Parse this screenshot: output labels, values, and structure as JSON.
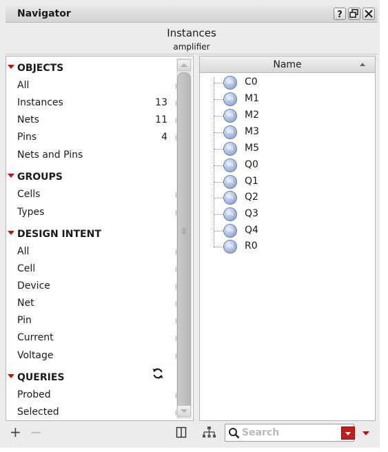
{
  "window": {
    "title": "Navigator"
  },
  "header": {
    "title": "Instances",
    "subtitle": "amplifier"
  },
  "sections": {
    "objects": {
      "title": "OBJECTS",
      "items": [
        {
          "label": "All",
          "count": ""
        },
        {
          "label": "Instances",
          "count": "13"
        },
        {
          "label": "Nets",
          "count": "11"
        },
        {
          "label": "Pins",
          "count": "4"
        },
        {
          "label": "Nets and Pins",
          "count": ""
        }
      ]
    },
    "groups": {
      "title": "GROUPS",
      "items": [
        {
          "label": "Cells"
        },
        {
          "label": "Types"
        }
      ]
    },
    "design_intent": {
      "title": "DESIGN INTENT",
      "items": [
        {
          "label": "All"
        },
        {
          "label": "Cell"
        },
        {
          "label": "Device"
        },
        {
          "label": "Net"
        },
        {
          "label": "Pin"
        },
        {
          "label": "Current"
        },
        {
          "label": "Voltage"
        }
      ]
    },
    "queries": {
      "title": "QUERIES",
      "items": [
        {
          "label": "Probed"
        },
        {
          "label": "Selected"
        }
      ]
    }
  },
  "table": {
    "column_header": "Name",
    "icon_text": "obj",
    "rows": [
      "C0",
      "M1",
      "M2",
      "M3",
      "M5",
      "Q0",
      "Q1",
      "Q2",
      "Q3",
      "Q4",
      "R0"
    ]
  },
  "toolbar": {
    "add_label": "+",
    "remove_label": "−",
    "search_placeholder": "Search"
  },
  "colors": {
    "accent_red": "#c01010"
  }
}
